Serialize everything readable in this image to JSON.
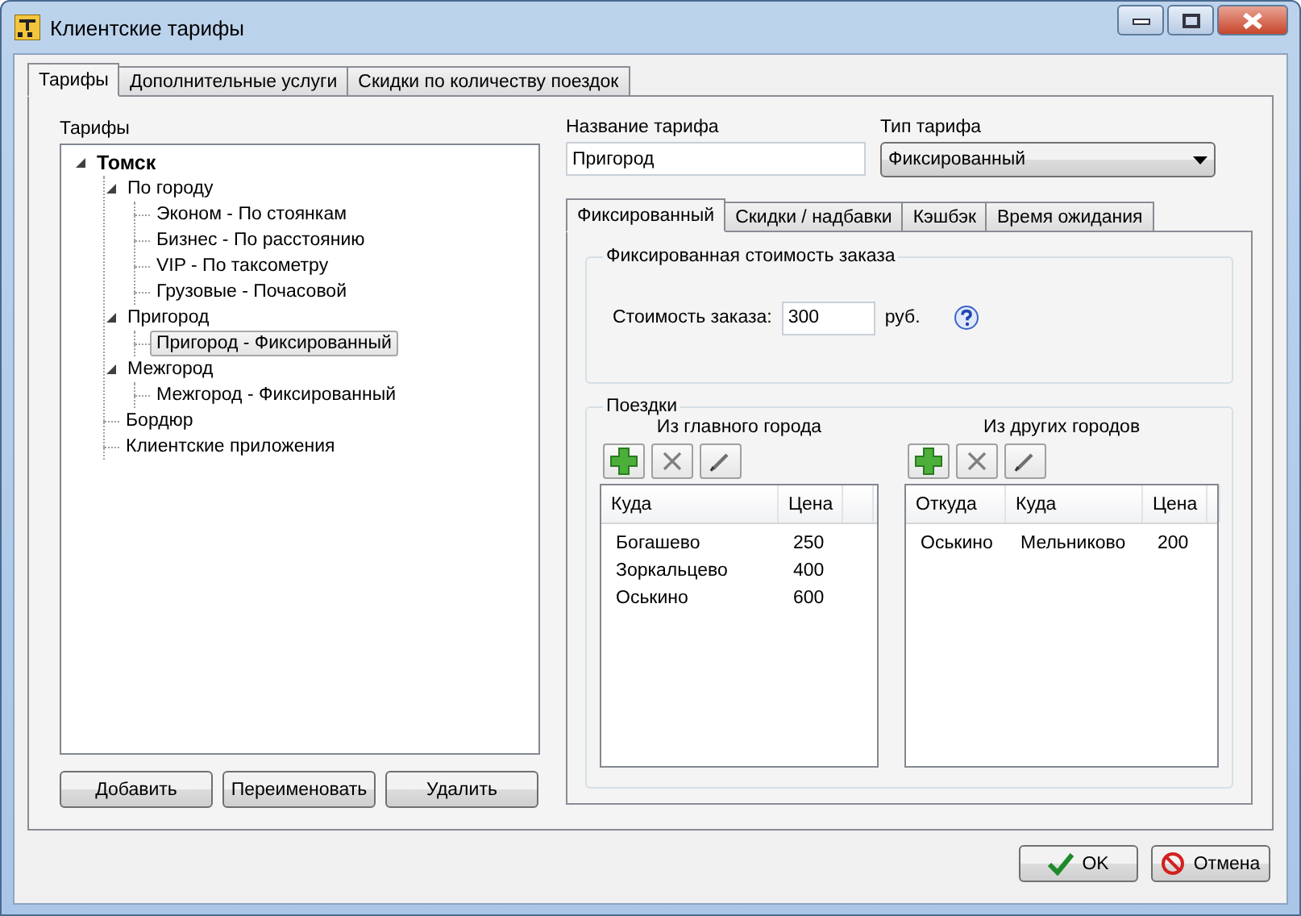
{
  "window": {
    "title": "Клиентские тарифы"
  },
  "tabs": [
    {
      "label": "Тарифы",
      "selected": true
    },
    {
      "label": "Дополнительные услуги",
      "selected": false
    },
    {
      "label": "Скидки по количеству поездок",
      "selected": false
    }
  ],
  "tree": {
    "label": "Тарифы",
    "items": [
      {
        "label": "Томск",
        "expanded": true,
        "selected": false,
        "children": [
          {
            "label": "По городу",
            "expanded": true,
            "selected": false,
            "children": [
              {
                "label": "Эконом - По стоянкам",
                "selected": false
              },
              {
                "label": "Бизнес - По расстоянию",
                "selected": false
              },
              {
                "label": "VIP - По таксометру",
                "selected": false
              },
              {
                "label": "Грузовые - Почасовой",
                "selected": false
              }
            ]
          },
          {
            "label": "Пригород",
            "expanded": true,
            "selected": false,
            "children": [
              {
                "label": "Пригород - Фиксированный",
                "selected": true
              }
            ]
          },
          {
            "label": "Межгород",
            "expanded": true,
            "selected": false,
            "children": [
              {
                "label": "Межгород - Фиксированный",
                "selected": false
              }
            ]
          },
          {
            "label": "Бордюр",
            "selected": false
          },
          {
            "label": "Клиентские приложения",
            "selected": false
          }
        ]
      }
    ],
    "buttons": [
      "Добавить",
      "Переименовать",
      "Удалить"
    ]
  },
  "tariff_name": {
    "label": "Название тарифа",
    "value": "Пригород"
  },
  "tariff_type": {
    "label": "Тип тарифа",
    "value": "Фиксированный"
  },
  "inner_tabs": [
    {
      "label": "Фиксированный",
      "selected": true
    },
    {
      "label": "Скидки / надбавки",
      "selected": false
    },
    {
      "label": "Кэшбэк",
      "selected": false
    },
    {
      "label": "Время ожидания",
      "selected": false
    }
  ],
  "fixed_cost": {
    "title": "Фиксированная стоимость заказа",
    "label": "Стоимость заказа:",
    "value": "300",
    "unit": "руб."
  },
  "trips": {
    "title": "Поездки",
    "lists": [
      {
        "title": "Из главного города",
        "columns": [
          "Куда",
          "Цена"
        ],
        "rows": [
          [
            "Богашево",
            "250"
          ],
          [
            "Зоркальцево",
            "400"
          ],
          [
            "Оськино",
            "600"
          ]
        ]
      },
      {
        "title": "Из других городов",
        "columns": [
          "Откуда",
          "Куда",
          "Цена"
        ],
        "rows": [
          [
            "Оськино",
            "Мельниково",
            "200"
          ]
        ]
      }
    ]
  },
  "dialog_buttons": [
    {
      "label": "OK",
      "kind": "ok"
    },
    {
      "label": "Отмена",
      "kind": "cancel"
    }
  ]
}
